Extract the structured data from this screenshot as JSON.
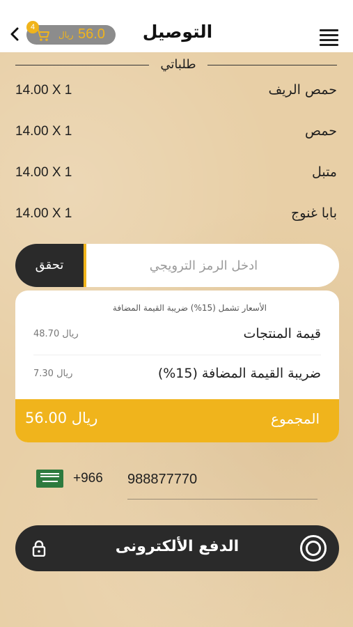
{
  "header": {
    "title": "التوصيل",
    "cart": {
      "badge_count": "4",
      "amount": "56.0",
      "currency": "ريال"
    }
  },
  "orders": {
    "section_title": "طلباتي",
    "items": [
      {
        "name": "حمص الريف",
        "qty_price": "14.00 X 1"
      },
      {
        "name": "حمص",
        "qty_price": "14.00 X 1"
      },
      {
        "name": "متبل",
        "qty_price": "14.00 X 1"
      },
      {
        "name": "بابا غنوج",
        "qty_price": "14.00 X 1"
      }
    ]
  },
  "promo": {
    "placeholder": "ادخل الرمز الترويجي",
    "button_label": "تحقق"
  },
  "summary": {
    "vat_note": "الأسعار تشمل (15%) ضريبة القيمة المضافة",
    "products_label": "قيمة المنتجات",
    "products_value": "48.70 ريال",
    "vat_label": "ضريبة القيمة المضافة (15%)",
    "vat_value": "7.30 ريال",
    "total_label": "المجموع",
    "total_value": "56.00 ريال"
  },
  "phone": {
    "country_code": "+966",
    "number": "988877770"
  },
  "payment": {
    "button_label": "الدفع الألكترونى"
  },
  "colors": {
    "accent": "#f0b41c",
    "dark": "#2a2a2a",
    "background": "#e8cfa6"
  }
}
